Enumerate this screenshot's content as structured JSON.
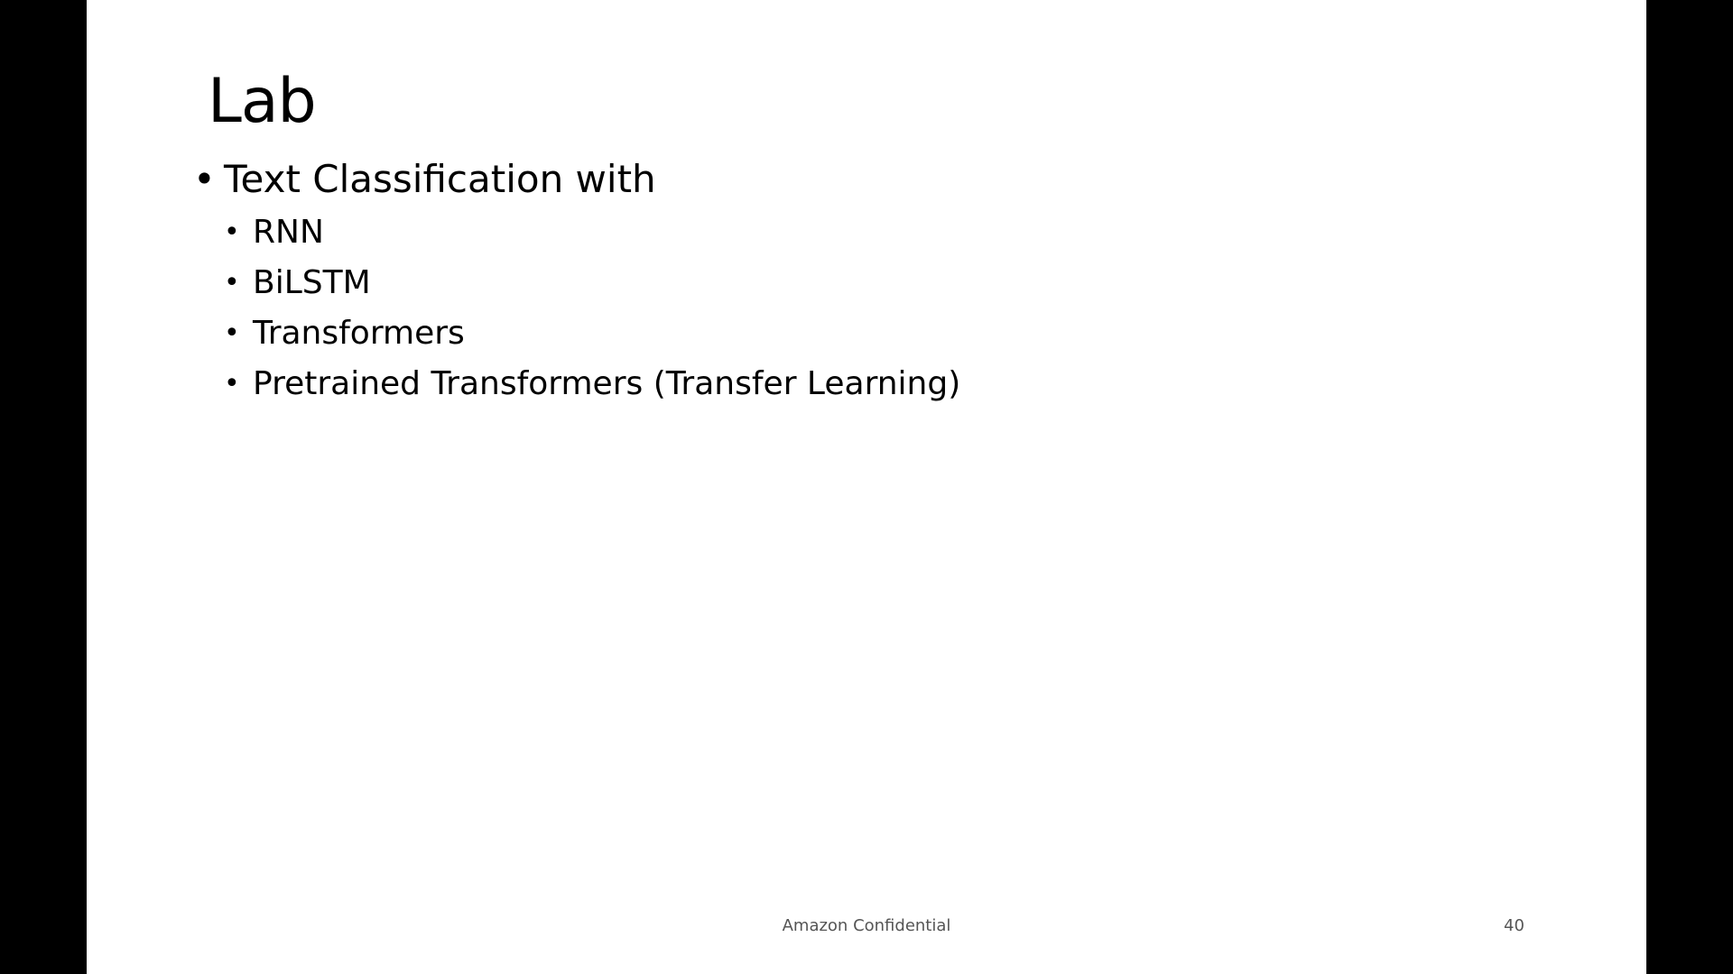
{
  "slide": {
    "title": "Lab",
    "bullets": [
      {
        "text": "Text Classification with",
        "sub": [
          "RNN",
          "BiLSTM",
          "Transformers",
          "Pretrained Transformers (Transfer Learning)"
        ]
      }
    ],
    "bullet_glyph": "•",
    "footer": "Amazon Confidential",
    "page_number": "40"
  },
  "colors": {
    "slide_background": "#ffffff",
    "letterbox": "#000000",
    "footer_text": "#555555"
  }
}
